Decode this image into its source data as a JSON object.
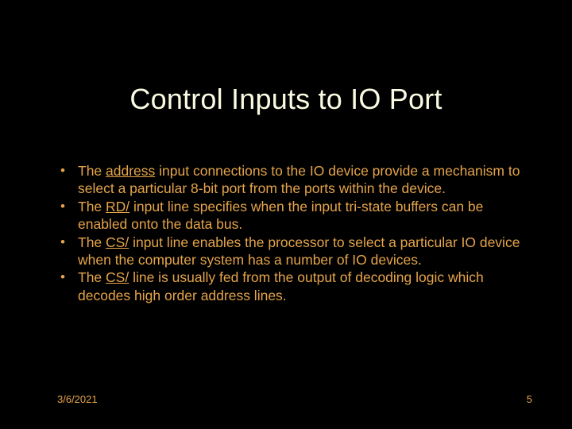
{
  "title": "Control Inputs to IO Port",
  "bullets": [
    {
      "pre": "The ",
      "u": "address",
      "post": " input connections to the IO device provide a mechanism to select a particular 8-bit port from the ports within the device."
    },
    {
      "pre": "The ",
      "u": "RD/",
      "post": " input line specifies when the input tri-state buffers can be enabled onto the data bus."
    },
    {
      "pre": "The ",
      "u": "CS/",
      "post": " input line enables the processor to select a particular IO device when the computer system has a number of IO devices."
    },
    {
      "pre": "The ",
      "u": "CS/",
      "post": " line is usually fed from the output of decoding logic which decodes high order address lines."
    }
  ],
  "footer": {
    "date": "3/6/2021",
    "page": "5"
  }
}
